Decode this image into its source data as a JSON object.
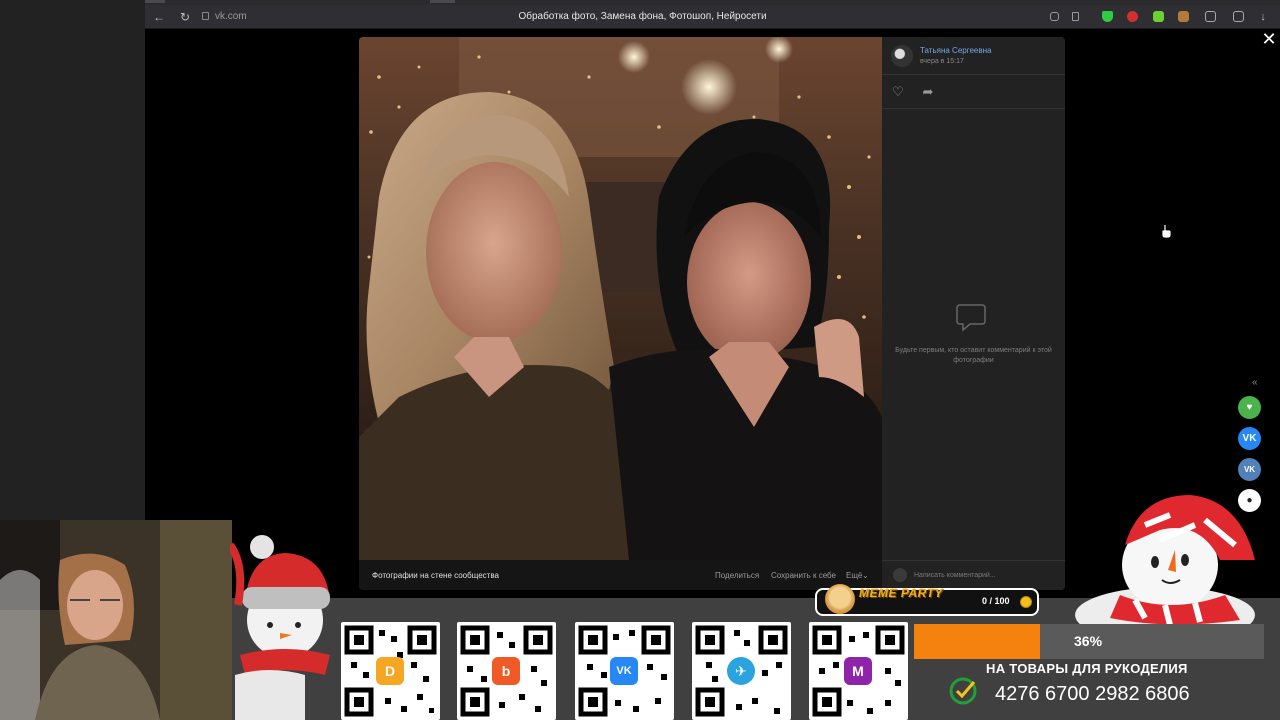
{
  "browser": {
    "url": "vk.com",
    "page_title": "Обработка фото, Замена фона, Фотошоп, Нейросети",
    "back_icon": "arrow-left-icon",
    "reload_icon": "reload-icon"
  },
  "viewer": {
    "author_name": "Татьяна Сергеевна",
    "author_time": "вчера в 15:17",
    "album_label": "Фотографии на стене сообщества",
    "actions": {
      "share": "Поделиться",
      "save": "Сохранить к себе",
      "more": "Ещё"
    },
    "empty_comments": "Будьте первым, кто оставит комментарий к этой фотографии",
    "comment_placeholder": "Написать комментарий...",
    "close_icon": "close-icon"
  },
  "overlay": {
    "meme": {
      "title": "MEME PARTY",
      "count": "0 / 100"
    },
    "goal": {
      "progress_text": "36%",
      "progress": 0.36,
      "title": "НА ТОВАРЫ ДЛЯ РУКОДЕЛИЯ",
      "card_number": "4276 6700 2982 6806"
    },
    "qr_codes": [
      {
        "logo": "D",
        "color": "#f5a623"
      },
      {
        "logo": "b",
        "color": "#ef5a27"
      },
      {
        "logo": "VK",
        "color": "#2787f5"
      },
      {
        "logo": "✈",
        "color": "#2aa3df"
      },
      {
        "logo": "M",
        "color": "#8e24aa"
      }
    ]
  },
  "colors": {
    "accent": "#71aaeb",
    "progress": "#f5820e",
    "overlay_bg": "#404040"
  }
}
